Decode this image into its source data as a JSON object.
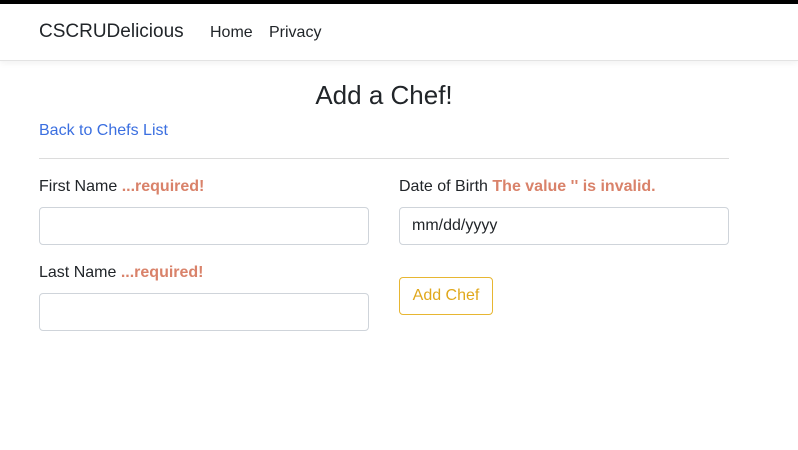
{
  "navbar": {
    "brand": "CSCRUDelicious",
    "links": [
      {
        "label": "Home"
      },
      {
        "label": "Privacy"
      }
    ]
  },
  "main": {
    "title": "Add a Chef!",
    "back_link": "Back to Chefs List",
    "form": {
      "first_name": {
        "label": "First Name",
        "validation": "...required!",
        "value": ""
      },
      "last_name": {
        "label": "Last Name",
        "validation": "...required!",
        "value": ""
      },
      "date_of_birth": {
        "label": "Date of Birth",
        "validation": "The value '' is invalid.",
        "placeholder": "mm/dd/yyyy"
      },
      "submit_label": "Add Chef"
    }
  },
  "colors": {
    "link": "#3b6fe0",
    "validation": "#d9826a",
    "button_accent": "#e0a81c",
    "top_bar": "#000000"
  }
}
